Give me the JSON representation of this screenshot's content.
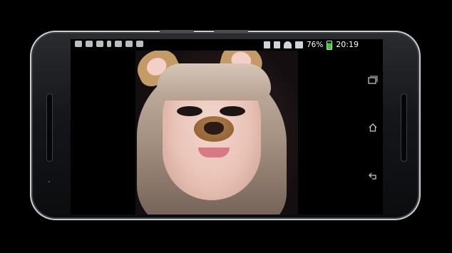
{
  "status_bar": {
    "left_icons": [
      "notification-icon-1",
      "shield-icon",
      "wrench-icon",
      "touch-icon",
      "image-icon",
      "card-icon",
      "screenshot-icon"
    ],
    "right_icons": [
      "bluetooth-icon",
      "sim-icon",
      "wifi-icon",
      "signal-icon",
      "battery-icon"
    ],
    "battery_percent": "76%",
    "battery_level": 0.76,
    "time": "20:19"
  },
  "nav_bar": {
    "buttons": [
      {
        "name": "recent-apps",
        "icon": "recent-apps-icon"
      },
      {
        "name": "home",
        "icon": "home-icon"
      },
      {
        "name": "back",
        "icon": "back-icon"
      }
    ]
  },
  "content": {
    "type": "camera-filter-preview",
    "filter": "dog-ears-snout"
  }
}
